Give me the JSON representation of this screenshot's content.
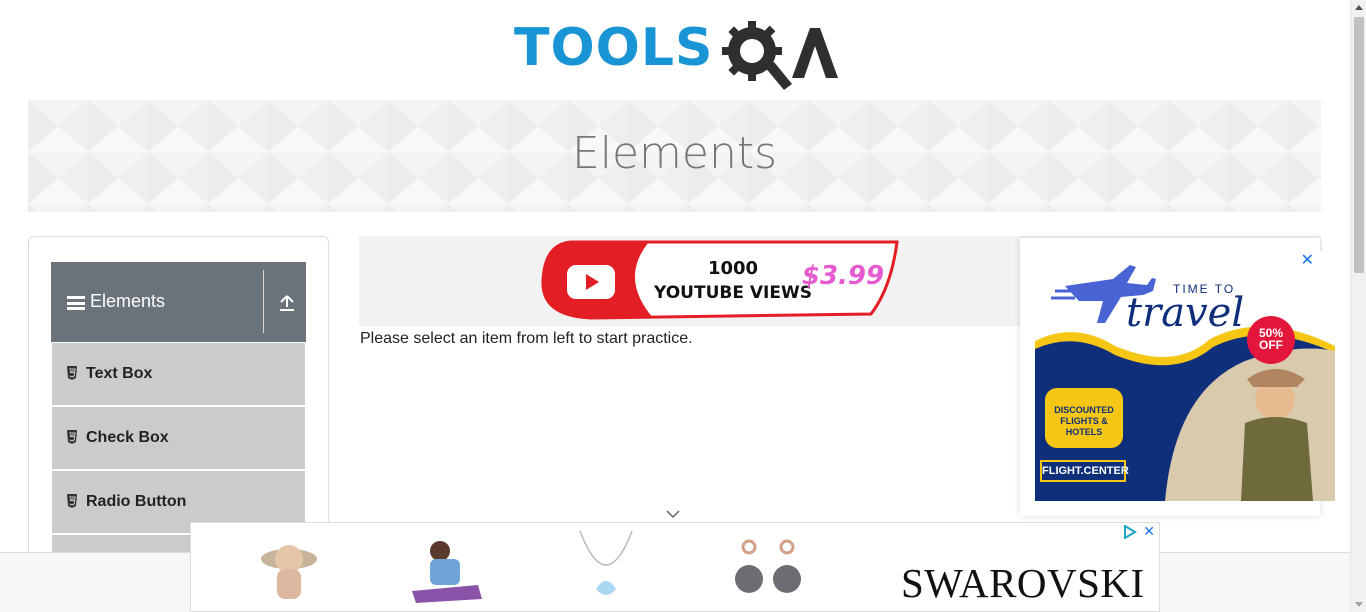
{
  "header": {
    "logo_text": "TOOLSQA",
    "logo_tools": "TOOLS",
    "brand_color": "#1994d4"
  },
  "banner": {
    "title": "Elements"
  },
  "sidebar": {
    "group_title": "Elements",
    "items": [
      {
        "label": "Text Box"
      },
      {
        "label": "Check Box"
      },
      {
        "label": "Radio Button"
      }
    ]
  },
  "main": {
    "prompt": "Please select an item from left to start practice."
  },
  "ads": {
    "center": {
      "line1": "1000",
      "line2": "YOUTUBE VIEWS",
      "price": "$3.99"
    },
    "travel": {
      "time_to": "TIME TO",
      "headline": "travel",
      "discount_line1": "50%",
      "discount_line2": "OFF",
      "badge_line1": "DISCOUNTED",
      "badge_line2": "FLIGHTS & HOTELS",
      "brand": "FLIGHT.CENTER",
      "close": "✕"
    },
    "bottom": {
      "brand": "SWAROVSKI",
      "close": "✕"
    }
  },
  "colors": {
    "sidebar_header": "#6b737a",
    "menu_item": "#cbcbcb",
    "ad_navy": "#0f2f7a",
    "ad_yellow": "#f6c615",
    "ad_red": "#e2173b"
  }
}
